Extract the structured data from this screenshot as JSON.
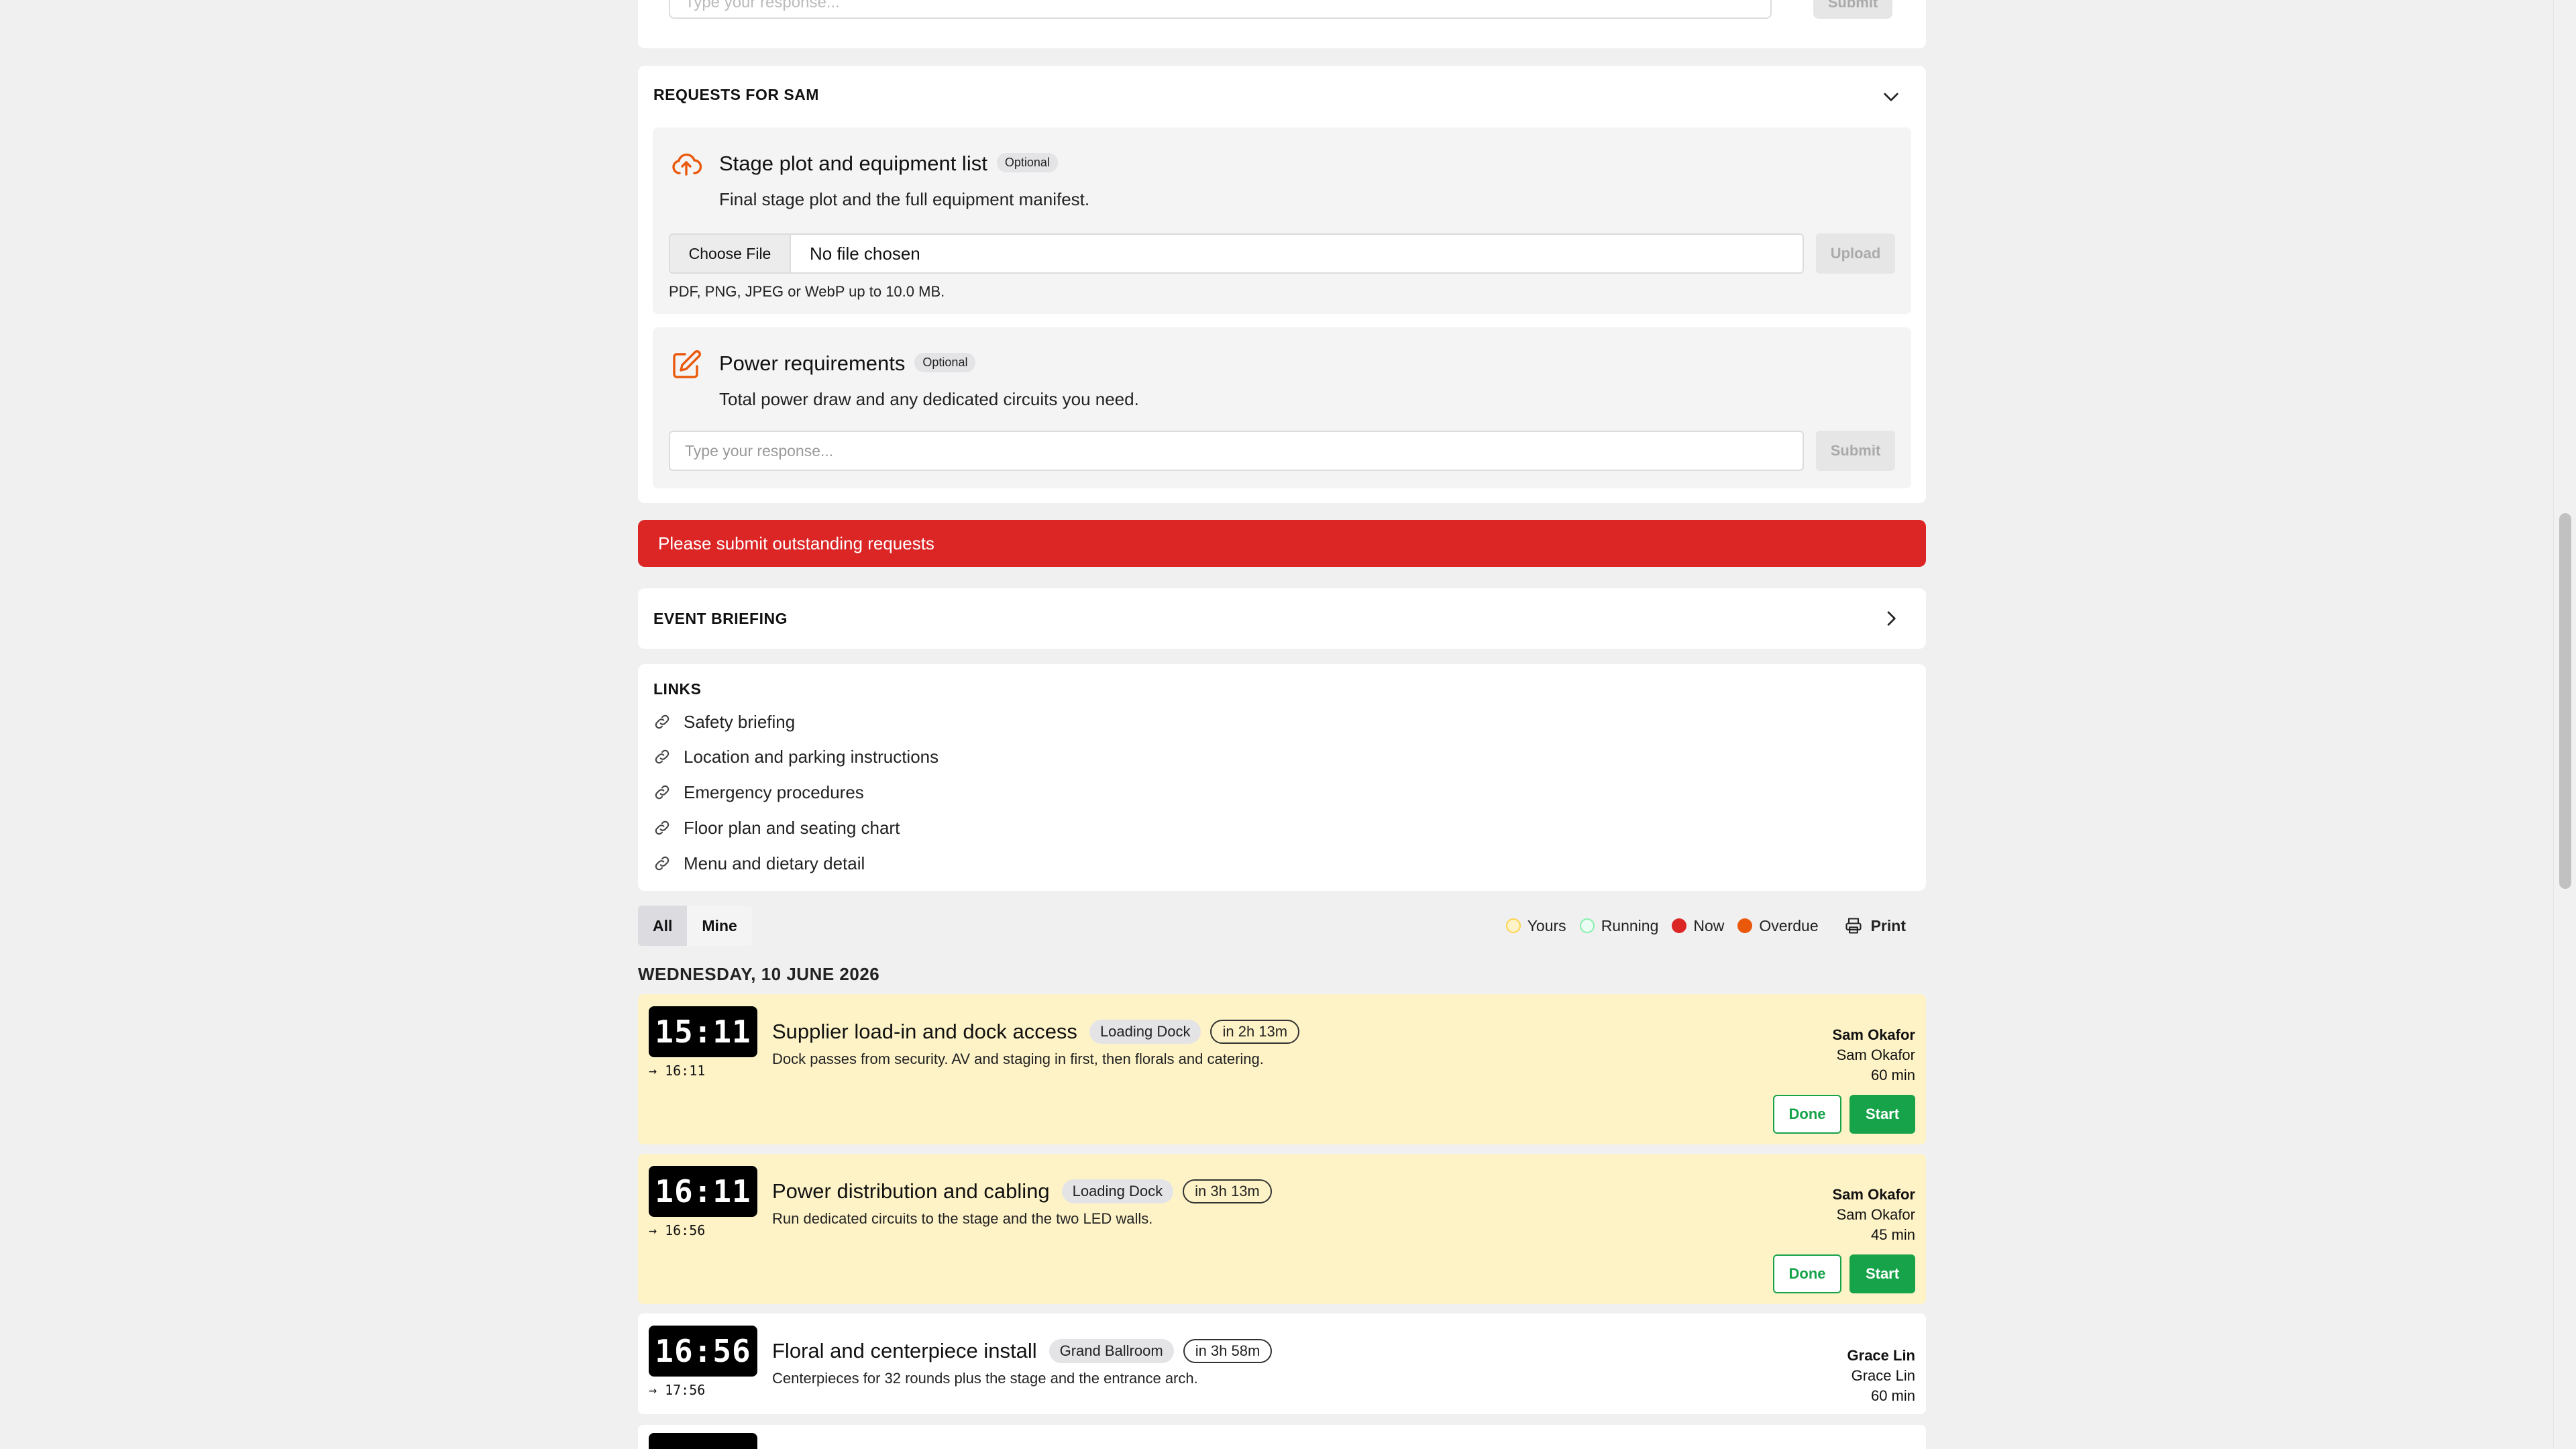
{
  "previous_request": {
    "placeholder": "Type your response...",
    "submit_label": "Submit"
  },
  "requests": {
    "heading": "REQUESTS FOR SAM",
    "items": [
      {
        "title": "Stage plot and equipment list",
        "badge": "Optional",
        "description": "Final stage plot and the full equipment manifest.",
        "choose_file_label": "Choose File",
        "file_status": "No file chosen",
        "upload_label": "Upload",
        "hint": "PDF, PNG, JPEG or WebP up to 10.0 MB.",
        "icon": "cloud-upload-icon"
      },
      {
        "title": "Power requirements",
        "badge": "Optional",
        "description": "Total power draw and any dedicated circuits you need.",
        "placeholder": "Type your response...",
        "submit_label": "Submit",
        "icon": "pencil-square-icon"
      }
    ]
  },
  "alert": {
    "text": "Please submit outstanding requests",
    "color": "#dc2626"
  },
  "briefing": {
    "heading": "EVENT BRIEFING"
  },
  "links": {
    "heading": "LINKS",
    "items": [
      "Safety briefing",
      "Location and parking instructions",
      "Emergency procedures",
      "Floor plan and seating chart",
      "Menu and dietary detail"
    ]
  },
  "filters": {
    "all_label": "All",
    "mine_label": "Mine",
    "legend": [
      {
        "label": "Yours",
        "color": "#fde68a"
      },
      {
        "label": "Running",
        "color": "#dcfce7"
      },
      {
        "label": "Now",
        "color": "#dc2626"
      },
      {
        "label": "Overdue",
        "color": "#ea580c"
      }
    ],
    "print_label": "Print"
  },
  "schedule": {
    "day": "WEDNESDAY, 10 JUNE 2026",
    "events": [
      {
        "start": "15:11",
        "end": "→ 16:11",
        "title": "Supplier load-in and dock access",
        "location": "Loading Dock",
        "eta": "in 2h 13m",
        "description": "Dock passes from security. AV and staging in first, then florals and catering.",
        "owner": "Sam Okafor",
        "assignee": "Sam Okafor",
        "duration": "60 min",
        "done_label": "Done",
        "start_label": "Start"
      },
      {
        "start": "16:11",
        "end": "→ 16:56",
        "title": "Power distribution and cabling",
        "location": "Loading Dock",
        "eta": "in 3h 13m",
        "description": "Run dedicated circuits to the stage and the two LED walls.",
        "owner": "Sam Okafor",
        "assignee": "Sam Okafor",
        "duration": "45 min",
        "done_label": "Done",
        "start_label": "Start"
      },
      {
        "start": "16:56",
        "end": "→ 17:56",
        "title": "Floral and centerpiece install",
        "location": "Grand Ballroom",
        "eta": "in 3h 58m",
        "description": "Centerpieces for 32 rounds plus the stage and the entrance arch.",
        "owner": "Grace Lin",
        "assignee": "Grace Lin",
        "duration": "60 min"
      }
    ]
  }
}
